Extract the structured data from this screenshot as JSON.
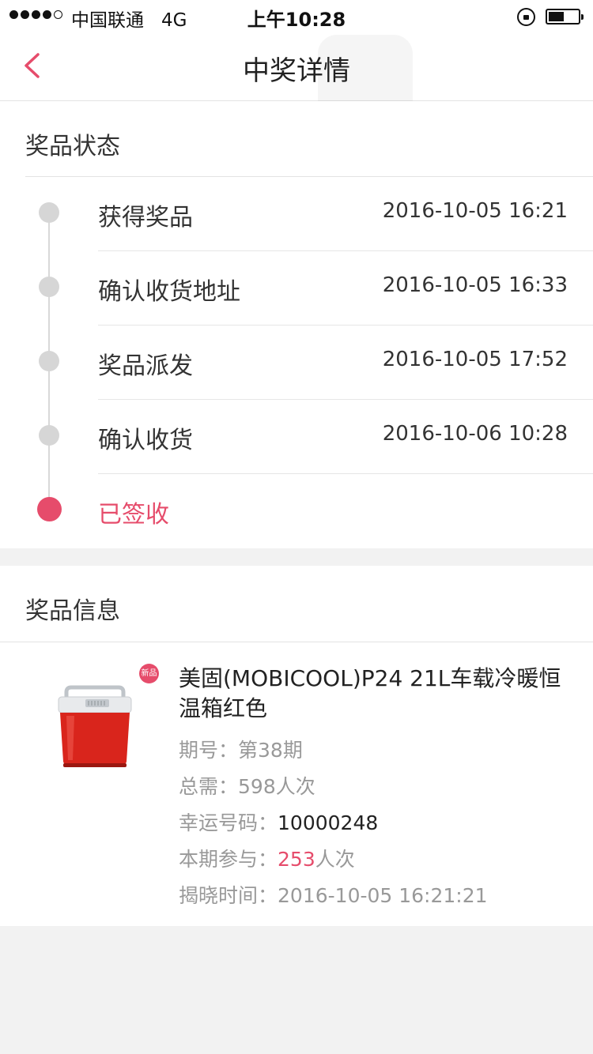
{
  "status_bar": {
    "carrier": "中国联通",
    "network": "4G",
    "time": "上午10:28"
  },
  "nav": {
    "title": "中奖详情"
  },
  "prize_status": {
    "title": "奖品状态",
    "steps": [
      {
        "label": "获得奖品",
        "time": "2016-10-05 16:21"
      },
      {
        "label": "确认收货地址",
        "time": "2016-10-05 16:33"
      },
      {
        "label": "奖品派发",
        "time": "2016-10-05 17:52"
      },
      {
        "label": "确认收货",
        "time": "2016-10-06 10:28"
      },
      {
        "label": "已签收",
        "time": ""
      }
    ],
    "active_color": "#e64c6b"
  },
  "prize_info": {
    "title": "奖品信息",
    "badge": "新品",
    "product_name": "美固(MOBICOOL)P24 21L车载冷暖恒温箱红色",
    "period_label": "期号：",
    "period_value": "第38期",
    "total_label": "总需：",
    "total_value": "598人次",
    "lucky_label": "幸运号码：",
    "lucky_value": "10000248",
    "join_label": "本期参与：",
    "join_value": "253",
    "join_unit": "人次",
    "reveal_label": "揭晓时间：",
    "reveal_value": "2016-10-05 16:21:21"
  }
}
